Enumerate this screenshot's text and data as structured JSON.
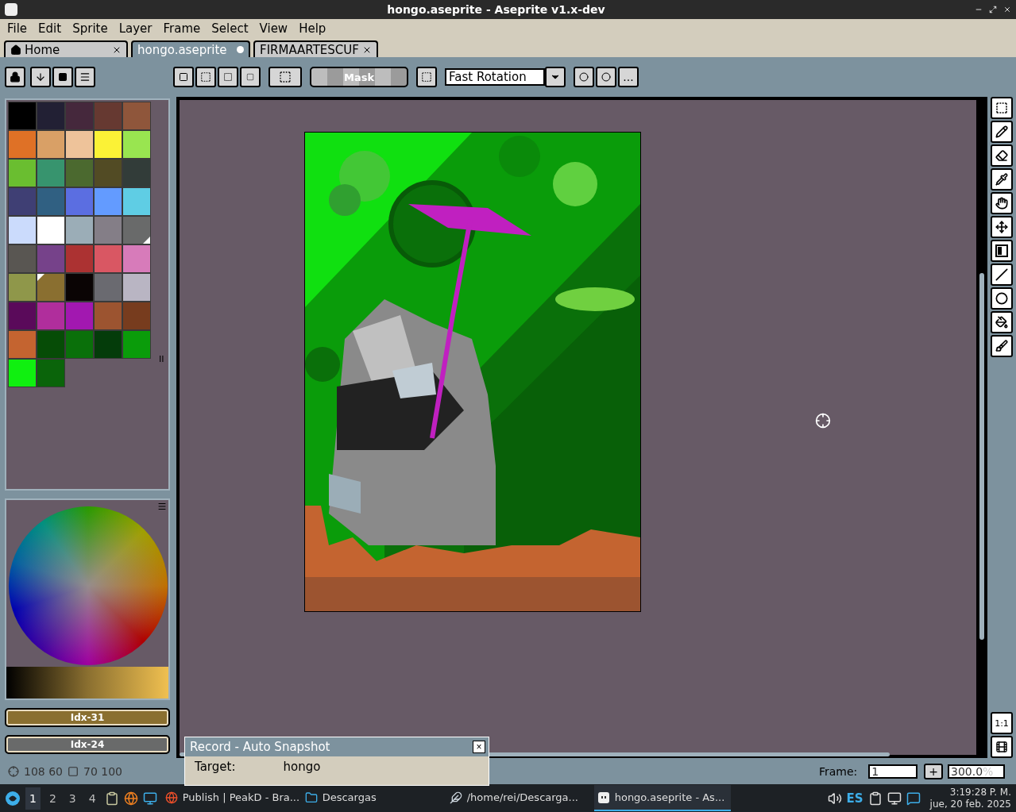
{
  "window": {
    "title": "hongo.aseprite - Aseprite v1.x-dev"
  },
  "menu": [
    "File",
    "Edit",
    "Sprite",
    "Layer",
    "Frame",
    "Select",
    "View",
    "Help"
  ],
  "tabs": [
    {
      "label": "Home",
      "kind": "home",
      "selected": false,
      "modified": false
    },
    {
      "label": "hongo.aseprite",
      "kind": "file",
      "selected": true,
      "modified": true
    },
    {
      "label": "FIRMAARTESCUF",
      "kind": "file",
      "selected": false,
      "modified": false
    }
  ],
  "toolbar": {
    "mask_label": "Mask",
    "rotation": "Fast Rotation",
    "more": "..."
  },
  "palette": {
    "grip": "II",
    "colors": [
      {
        "color": "#000000",
        "fg": false,
        "bg": false
      },
      {
        "color": "#222034",
        "fg": false,
        "bg": false
      },
      {
        "color": "#45283c",
        "fg": false,
        "bg": false
      },
      {
        "color": "#663931",
        "fg": false,
        "bg": false
      },
      {
        "color": "#8f563b",
        "fg": false,
        "bg": false
      },
      {
        "color": "#df7126",
        "fg": false,
        "bg": false
      },
      {
        "color": "#d9a066",
        "fg": false,
        "bg": false
      },
      {
        "color": "#eec39a",
        "fg": false,
        "bg": false
      },
      {
        "color": "#fbf236",
        "fg": false,
        "bg": false
      },
      {
        "color": "#99e550",
        "fg": false,
        "bg": false
      },
      {
        "color": "#6abe30",
        "fg": false,
        "bg": false
      },
      {
        "color": "#37946e",
        "fg": false,
        "bg": false
      },
      {
        "color": "#4b692f",
        "fg": false,
        "bg": false
      },
      {
        "color": "#524b24",
        "fg": false,
        "bg": false
      },
      {
        "color": "#323c39",
        "fg": false,
        "bg": false
      },
      {
        "color": "#3f3f74",
        "fg": false,
        "bg": false
      },
      {
        "color": "#306082",
        "fg": false,
        "bg": false
      },
      {
        "color": "#5b6ee1",
        "fg": false,
        "bg": false
      },
      {
        "color": "#639bff",
        "fg": false,
        "bg": false
      },
      {
        "color": "#5fcde4",
        "fg": false,
        "bg": false
      },
      {
        "color": "#cbdbfc",
        "fg": false,
        "bg": false
      },
      {
        "color": "#ffffff",
        "fg": false,
        "bg": false
      },
      {
        "color": "#9badb7",
        "fg": false,
        "bg": false
      },
      {
        "color": "#847e87",
        "fg": false,
        "bg": false
      },
      {
        "color": "#696a6a",
        "fg": false,
        "bg": true
      },
      {
        "color": "#595652",
        "fg": false,
        "bg": false
      },
      {
        "color": "#76428a",
        "fg": false,
        "bg": false
      },
      {
        "color": "#ac3232",
        "fg": false,
        "bg": false
      },
      {
        "color": "#d95763",
        "fg": false,
        "bg": false
      },
      {
        "color": "#d77bba",
        "fg": false,
        "bg": false
      },
      {
        "color": "#8f974a",
        "fg": false,
        "bg": false
      },
      {
        "color": "#8a6f30",
        "fg": true,
        "bg": false
      },
      {
        "color": "#0a0404",
        "fg": false,
        "bg": false
      },
      {
        "color": "#6a6a70",
        "fg": false,
        "bg": false
      },
      {
        "color": "#b9b5c3",
        "fg": false,
        "bg": false
      },
      {
        "color": "#5a0a5a",
        "fg": false,
        "bg": false
      },
      {
        "color": "#b02e9c",
        "fg": false,
        "bg": false
      },
      {
        "color": "#a218b0",
        "fg": false,
        "bg": false
      },
      {
        "color": "#9c5430",
        "fg": false,
        "bg": false
      },
      {
        "color": "#773c1e",
        "fg": false,
        "bg": false
      },
      {
        "color": "#c46430",
        "fg": false,
        "bg": false
      },
      {
        "color": "#064c06",
        "fg": false,
        "bg": false
      },
      {
        "color": "#0a700a",
        "fg": false,
        "bg": false
      },
      {
        "color": "#043c0a",
        "fg": false,
        "bg": false
      },
      {
        "color": "#0a9c0a",
        "fg": false,
        "bg": false
      },
      {
        "color": "#10f010",
        "fg": false,
        "bg": false
      },
      {
        "color": "#0a640a",
        "fg": false,
        "bg": false
      }
    ]
  },
  "color_buttons": [
    {
      "label": "Idx-31",
      "color": "#8a6f30"
    },
    {
      "label": "Idx-24",
      "color": "#696a6a"
    }
  ],
  "status": {
    "position": "108 60",
    "size": "70 100",
    "frame_label": "Frame:",
    "frame_value": "1",
    "add": "+",
    "zoom": "300.0",
    "zoom_unit": "%"
  },
  "side_tools": {
    "actual_size": "1:1"
  },
  "record_dialog": {
    "title": "Record - Auto Snapshot",
    "close": "×",
    "target_label": "Target:",
    "target_value": "hongo"
  },
  "taskbar": {
    "workspaces": [
      {
        "label": "1",
        "selected": true
      },
      {
        "label": "2",
        "selected": false
      },
      {
        "label": "3",
        "selected": false
      },
      {
        "label": "4",
        "selected": false
      }
    ],
    "tasks": [
      {
        "label": "Publish | PeakD - Bra...",
        "kind": "browser",
        "selected": false
      },
      {
        "label": "Descargas",
        "kind": "folder",
        "selected": false
      },
      {
        "label": "/home/rei/Descarga...",
        "kind": "editor",
        "selected": false
      },
      {
        "label": "hongo.aseprite - As...",
        "kind": "aseprite",
        "selected": true
      }
    ],
    "language": "ES",
    "time": "3:19:28 P. M.",
    "date": "jue, 20 feb. 2025"
  }
}
